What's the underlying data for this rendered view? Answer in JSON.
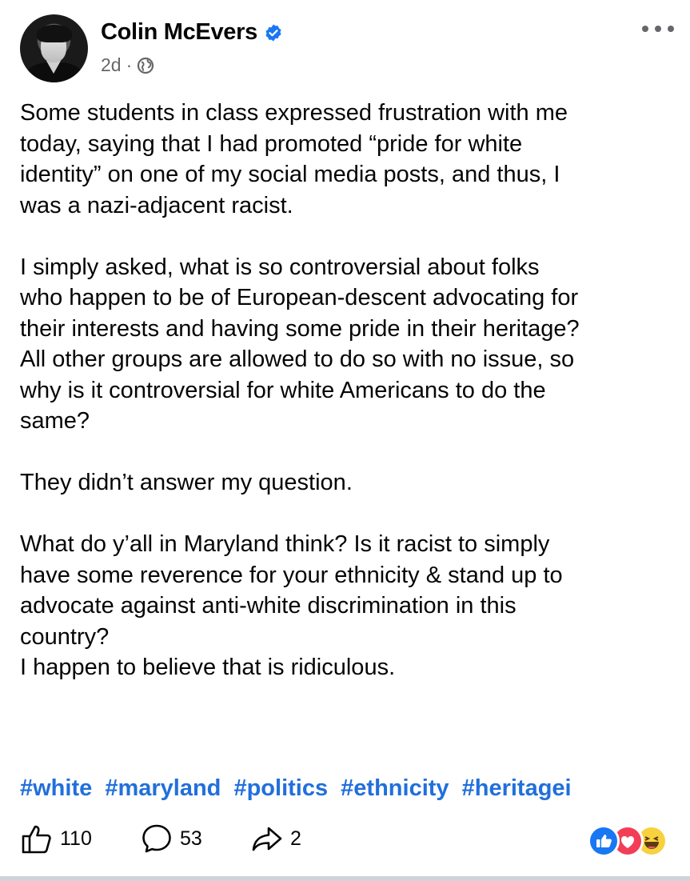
{
  "post": {
    "author": "Colin McEvers",
    "time": "2d",
    "separator": "·",
    "icons": {
      "verified": "verified-badge-icon",
      "audience": "globe-icon",
      "more": "more-options-icon"
    },
    "paragraphs": [
      [
        "Some students in class expressed frustration with me",
        "today, saying that I had promoted “pride for white",
        "identity” on one of my social media posts, and thus, I",
        "was a nazi-adjacent racist."
      ],
      [
        "I simply asked, what is so controversial about folks",
        "who happen to be of European-descent advocating for",
        "their interests and having some pride in their heritage?",
        "All other groups are allowed to do so with no issue, so",
        "why is it controversial for white Americans to do the",
        "same?"
      ],
      [
        "They didn’t answer my question."
      ],
      [
        "What do y’all in Maryland think? Is it racist to simply",
        "have some reverence for your ethnicity & stand up to",
        "advocate against anti-white discrimination in this",
        "country?",
        "I happen to believe that is ridiculous."
      ]
    ],
    "hashtags": [
      "#white",
      "#maryland",
      "#politics",
      "#ethnicity",
      "#heritagei"
    ],
    "hashtag_color": "#216fdb",
    "likes": "110",
    "comments": "53",
    "shares": "2",
    "reactions": [
      "like",
      "love",
      "haha"
    ]
  }
}
